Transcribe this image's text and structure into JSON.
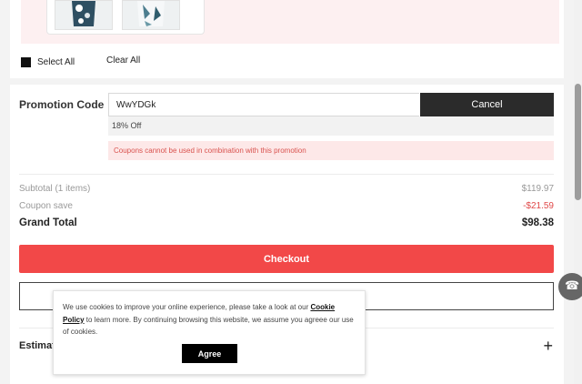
{
  "selection": {
    "select_all_label": "Select All",
    "clear_all_label": "Clear All"
  },
  "promotion": {
    "label": "Promotion Code",
    "code_value": "WwYDGk",
    "cancel_label": "Cancel",
    "discount_text": "18% Off",
    "warning_text": "Coupons cannot be used in combination with this promotion"
  },
  "summary": {
    "subtotal_label": "Subtotal (1 items)",
    "subtotal_value": "$119.97",
    "coupon_label": "Coupon save",
    "coupon_value": "-$21.59",
    "grand_label": "Grand Total",
    "grand_value": "$98.38"
  },
  "checkout_label": "Checkout",
  "estimate_label": "Estimat",
  "cookie": {
    "text_before_link": "We use cookies to improve your online experience, please take a look at our ",
    "link_text": "Cookie Policy",
    "text_after_link": " to learn more. By continuing browsing this website, we assume you agreee our use of cookies.",
    "agree_label": "Agree"
  },
  "icons": {
    "plus": "plus-icon",
    "headset": "headset-icon"
  },
  "colors": {
    "accent": "#f24848",
    "dark_button": "#2b2b2b",
    "warning_text": "#d9534f",
    "warning_bg": "#fde8e8"
  }
}
